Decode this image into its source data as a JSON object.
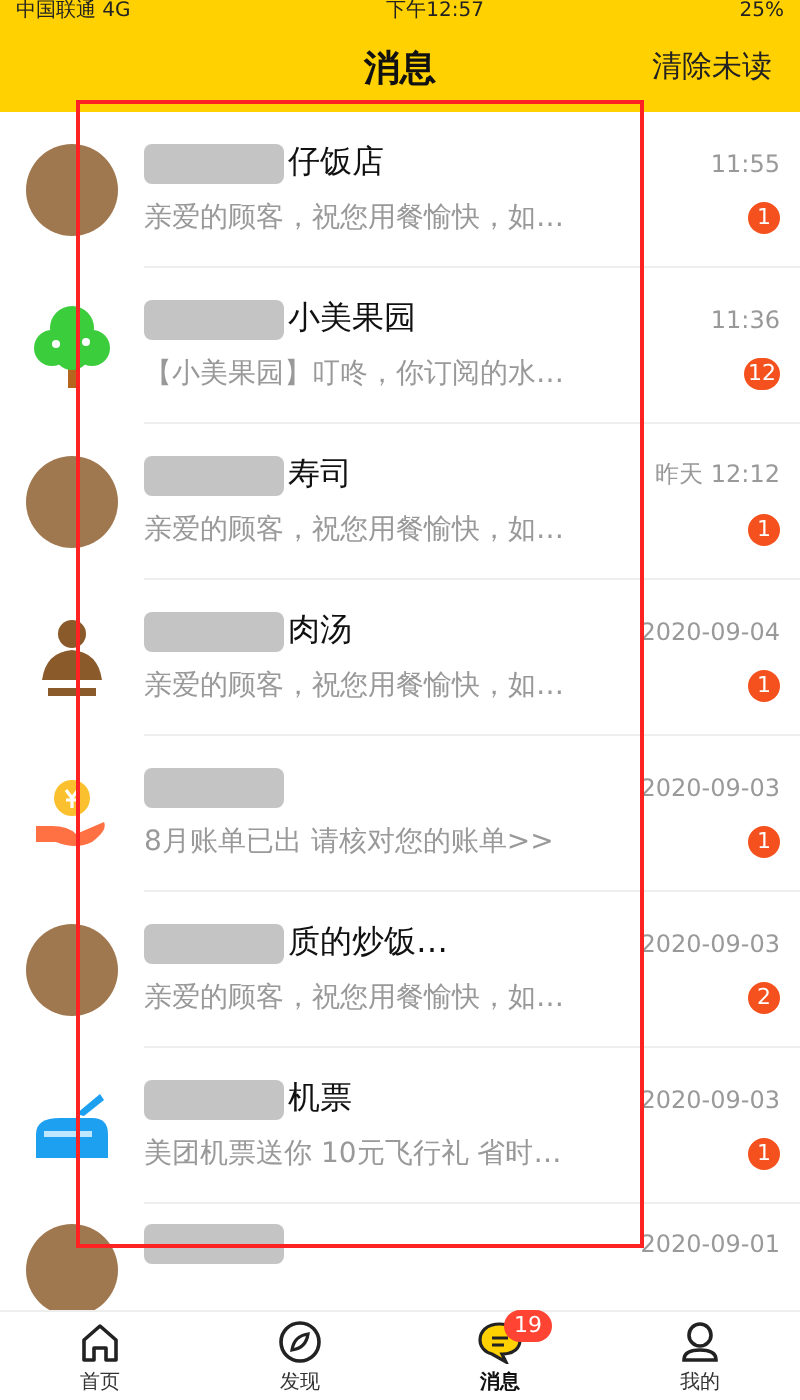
{
  "status_bar": {
    "carrier": "中国联通 4G",
    "time": "下午12:57",
    "battery": "25%"
  },
  "header": {
    "title": "消息",
    "action": "清除未读"
  },
  "messages": [
    {
      "kind": "photo",
      "name": "仔饭店",
      "preview": "亲爱的顾客，祝您用餐愉快，如…",
      "time": "11:55",
      "unread": "1"
    },
    {
      "kind": "tree",
      "name": "小美果园",
      "preview": "【小美果园】叮咚，你订阅的水…",
      "time": "11:36",
      "unread": "12"
    },
    {
      "kind": "photo",
      "name": "寿司",
      "preview": "亲爱的顾客，祝您用餐愉快，如…",
      "time": "昨天 12:12",
      "unread": "1"
    },
    {
      "kind": "person",
      "name": "肉汤",
      "preview": "亲爱的顾客，祝您用餐愉快，如…",
      "time": "2020-09-04",
      "unread": "1"
    },
    {
      "kind": "coin",
      "preview": "8月账单已出 请核对您的账单>>",
      "time": "2020-09-03",
      "unread": "1"
    },
    {
      "kind": "photo",
      "name": "质的炒饭…",
      "preview": "亲爱的顾客，祝您用餐愉快，如…",
      "time": "2020-09-03",
      "unread": "2"
    },
    {
      "kind": "plane",
      "name": "机票",
      "preview": "美团机票送你 10元飞行礼 省时…",
      "time": "2020-09-03",
      "unread": "1"
    },
    {
      "kind": "photo",
      "time": "2020-09-01"
    }
  ],
  "tab_bar": [
    {
      "kind": "home",
      "label": "首页",
      "selected": false
    },
    {
      "kind": "discover",
      "label": "发现",
      "selected": false
    },
    {
      "kind": "message",
      "label": "消息",
      "selected": true,
      "badge": "19"
    },
    {
      "kind": "profile",
      "label": "我的",
      "selected": false
    }
  ]
}
